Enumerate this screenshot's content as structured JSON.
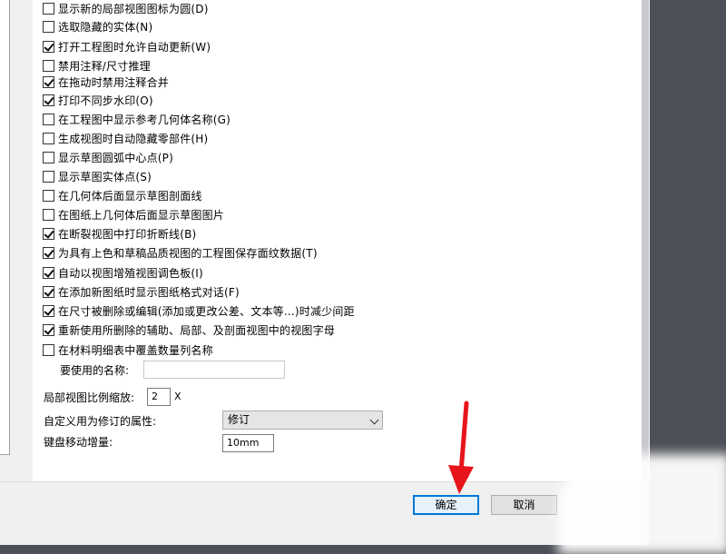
{
  "options": [
    {
      "label": "显示新的局部视图图标为圆(D)",
      "checked": false
    },
    {
      "label": "选取隐藏的实体(N)",
      "checked": false
    },
    {
      "label": "打开工程图时允许自动更新(W)",
      "checked": true
    },
    {
      "label": "禁用注释/尺寸推理",
      "checked": false
    },
    {
      "label": "在拖动时禁用注释合并",
      "checked": true
    },
    {
      "label": "打印不同步水印(O)",
      "checked": true
    },
    {
      "label": "在工程图中显示参考几何体名称(G)",
      "checked": false
    },
    {
      "label": "生成视图时自动隐藏零部件(H)",
      "checked": false
    },
    {
      "label": "显示草图圆弧中心点(P)",
      "checked": false
    },
    {
      "label": "显示草图实体点(S)",
      "checked": false
    },
    {
      "label": "在几何体后面显示草图剖面线",
      "checked": false
    },
    {
      "label": "在图纸上几何体后面显示草图图片",
      "checked": false
    },
    {
      "label": "在断裂视图中打印折断线(B)",
      "checked": true
    },
    {
      "label": "为具有上色和草稿品质视图的工程图保存面纹数据(T)",
      "checked": true
    },
    {
      "label": "自动以视图增殖视图调色板(I)",
      "checked": true
    },
    {
      "label": "在添加新图纸时显示图纸格式对话(F)",
      "checked": true
    },
    {
      "label": "在尺寸被删除或编辑(添加或更改公差、文本等...)时减少间距",
      "checked": true
    },
    {
      "label": "重新使用所删除的辅助、局部、及剖面视图中的视图字母",
      "checked": true
    },
    {
      "label": "在材料明细表中覆盖数量列名称",
      "checked": false
    }
  ],
  "name_to_use": {
    "label": "要使用的名称:",
    "value": ""
  },
  "detail_scale": {
    "label": "局部视图比例缩放:",
    "value": "2",
    "unit": "X"
  },
  "custom_property": {
    "label": "自定义用为修订的属性:",
    "value": "修订"
  },
  "keyboard_increment": {
    "label": "键盘移动增量:",
    "value": "10mm"
  },
  "buttons": {
    "ok": "确定",
    "cancel": "取消"
  },
  "colors": {
    "accent": "#0078d7",
    "arrow": "#e8141b"
  }
}
